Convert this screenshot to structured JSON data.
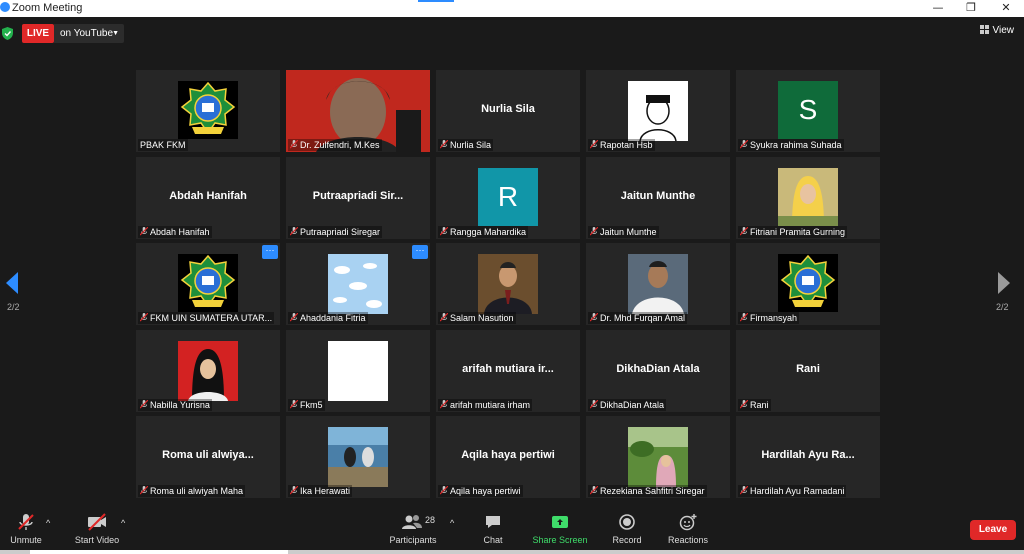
{
  "window": {
    "title": "Zoom Meeting",
    "minimize": "—",
    "restore": "❐",
    "close": "✕"
  },
  "topbar": {
    "live_badge": "LIVE",
    "live_destination": "on YouTube",
    "view_label": "View"
  },
  "pagination": {
    "prev_page_label": "2/2",
    "next_page_label": "2/2"
  },
  "participants": [
    {
      "display_name": "",
      "label": "PBAK FKM",
      "muted": false,
      "avatar": "logo-emblem"
    },
    {
      "display_name": "",
      "label": "Dr. Zulfendri, M.Kes",
      "muted": true,
      "avatar": "photo-man-red"
    },
    {
      "display_name": "Nurlia Sila",
      "label": "Nurlia Sila",
      "muted": true,
      "avatar": "none"
    },
    {
      "display_name": "",
      "label": "Rapotan Hsb",
      "muted": true,
      "avatar": "sketch-portrait"
    },
    {
      "display_name": "S",
      "label": "Syukra rahima Suhada",
      "muted": true,
      "avatar": "letter-green"
    },
    {
      "display_name": "Abdah Hanifah",
      "label": "Abdah Hanifah",
      "muted": true,
      "avatar": "none"
    },
    {
      "display_name": "Putraapriadi  Sir...",
      "label": "Putraapriadi Siregar",
      "muted": true,
      "avatar": "none"
    },
    {
      "display_name": "R",
      "label": "Rangga Mahardika",
      "muted": true,
      "avatar": "letter-teal"
    },
    {
      "display_name": "Jaitun Munthe",
      "label": "Jaitun Munthe",
      "muted": true,
      "avatar": "none"
    },
    {
      "display_name": "",
      "label": "Fitriani Pramita Gurning",
      "muted": true,
      "avatar": "photo-hijab"
    },
    {
      "display_name": "",
      "label": "FKM UIN SUMATERA UTAR...",
      "muted": true,
      "avatar": "logo-emblem",
      "more": "···"
    },
    {
      "display_name": "",
      "label": "Ahaddania Fitria",
      "muted": true,
      "avatar": "clouds",
      "more": "···"
    },
    {
      "display_name": "",
      "label": "Salam Nasution",
      "muted": true,
      "avatar": "photo-man-suit"
    },
    {
      "display_name": "",
      "label": "Dr. Mhd Furqan Amal",
      "muted": true,
      "avatar": "photo-man-white"
    },
    {
      "display_name": "",
      "label": "Firmansyah",
      "muted": true,
      "avatar": "logo-emblem"
    },
    {
      "display_name": "",
      "label": "Nabilla Yurisna",
      "muted": true,
      "avatar": "photo-hijab-red"
    },
    {
      "display_name": "",
      "label": "Fkm5",
      "muted": true,
      "avatar": "white-square"
    },
    {
      "display_name": "arifah mutiara ir...",
      "label": "arifah mutiara irham",
      "muted": true,
      "avatar": "none"
    },
    {
      "display_name": "DikhaDian Atala",
      "label": "DikhaDian Atala",
      "muted": true,
      "avatar": "none"
    },
    {
      "display_name": "Rani",
      "label": "Rani",
      "muted": true,
      "avatar": "none"
    },
    {
      "display_name": "Roma uli alwiya...",
      "label": "Roma uli alwiyah Maha",
      "muted": true,
      "avatar": "none"
    },
    {
      "display_name": "",
      "label": "Ika Herawati",
      "muted": true,
      "avatar": "photo-group"
    },
    {
      "display_name": "Aqila haya pertiwi",
      "label": "Aqila haya pertiwi",
      "muted": true,
      "avatar": "none"
    },
    {
      "display_name": "",
      "label": "Rezekiana Sahfitri Siregar",
      "muted": true,
      "avatar": "photo-garden"
    },
    {
      "display_name": "Hardilah Ayu Ra...",
      "label": "Hardilah Ayu Ramadani",
      "muted": true,
      "avatar": "none"
    }
  ],
  "toolbar": {
    "unmute": "Unmute",
    "start_video": "Start Video",
    "participants": "Participants",
    "participant_count": "28",
    "chat": "Chat",
    "share_screen": "Share Screen",
    "record": "Record",
    "reactions": "Reactions",
    "leave": "Leave",
    "caret": "^"
  },
  "colors": {
    "live": "#e02828",
    "accent": "#2d8cff",
    "share": "#3fdc6a",
    "tile_bg": "#262626"
  }
}
